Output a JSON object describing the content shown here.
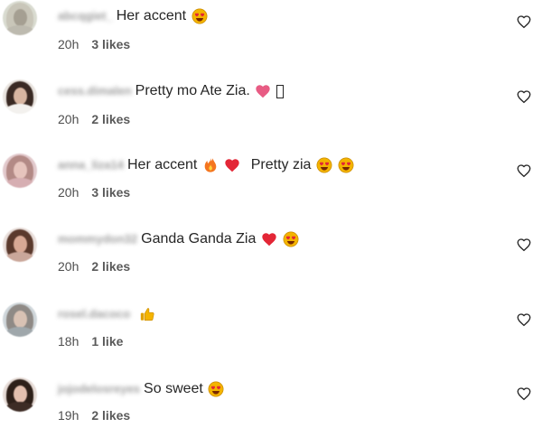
{
  "comments": [
    {
      "username": "abcqgiet_",
      "text": "Her accent",
      "emojis": [
        "heart-eyes"
      ],
      "time": "20h",
      "likes": "3 likes",
      "avatar": {
        "bg": "#d9dbd0",
        "hair": "#c9c6b9",
        "face": "#a59f92",
        "clothes": "#bdbaaf"
      }
    },
    {
      "username": "cess.dimalen",
      "text": "Pretty mo Ate Zia.",
      "emojis": [
        "pink-heart"
      ],
      "has_box": true,
      "time": "20h",
      "likes": "2 likes",
      "avatar": {
        "bg": "#e9e4df",
        "hair": "#3a2a24",
        "face": "#d7b5a1",
        "clothes": "#f3f1ee"
      }
    },
    {
      "username": "anna_liza14",
      "text": "Her accent",
      "emojis": [
        "fire",
        "red-heart"
      ],
      "text2": "Pretty zia",
      "emojis2": [
        "heart-eyes",
        "heart-eyes"
      ],
      "time": "20h",
      "likes": "3 likes",
      "avatar": {
        "bg": "#e2c9cc",
        "hair": "#b38a86",
        "face": "#e6c4bd",
        "clothes": "#d6aeb2"
      }
    },
    {
      "username": "mommydon32",
      "text": "Ganda Ganda Zia",
      "emojis": [
        "red-heart",
        "heart-eyes"
      ],
      "time": "20h",
      "likes": "2 likes",
      "avatar": {
        "bg": "#e8ddd9",
        "hair": "#5b3a2d",
        "face": "#d8a995",
        "clothes": "#caa79a"
      }
    },
    {
      "username": "rosel.dacoco",
      "text": "",
      "emojis": [
        "thumbs-up"
      ],
      "time": "18h",
      "likes": "1 like",
      "avatar": {
        "bg": "#cfd6da",
        "hair": "#8f8a86",
        "face": "#d9c2b4",
        "clothes": "#9fa7ab"
      }
    },
    {
      "username": "jojodelosreyes",
      "text": "So sweet",
      "emojis": [
        "heart-eyes"
      ],
      "time": "19h",
      "likes": "2 likes",
      "avatar": {
        "bg": "#e6dbd6",
        "hair": "#2e2019",
        "face": "#e3bfae",
        "clothes": "#3d2c25"
      }
    }
  ],
  "colors": {
    "text": "#262626",
    "meta": "#4f4f4f",
    "heart_red": "#e32636",
    "heart_pink": "#e85c84",
    "emoji_yellow": "#f4b400"
  },
  "icons": {
    "like": "heart-outline-icon"
  }
}
